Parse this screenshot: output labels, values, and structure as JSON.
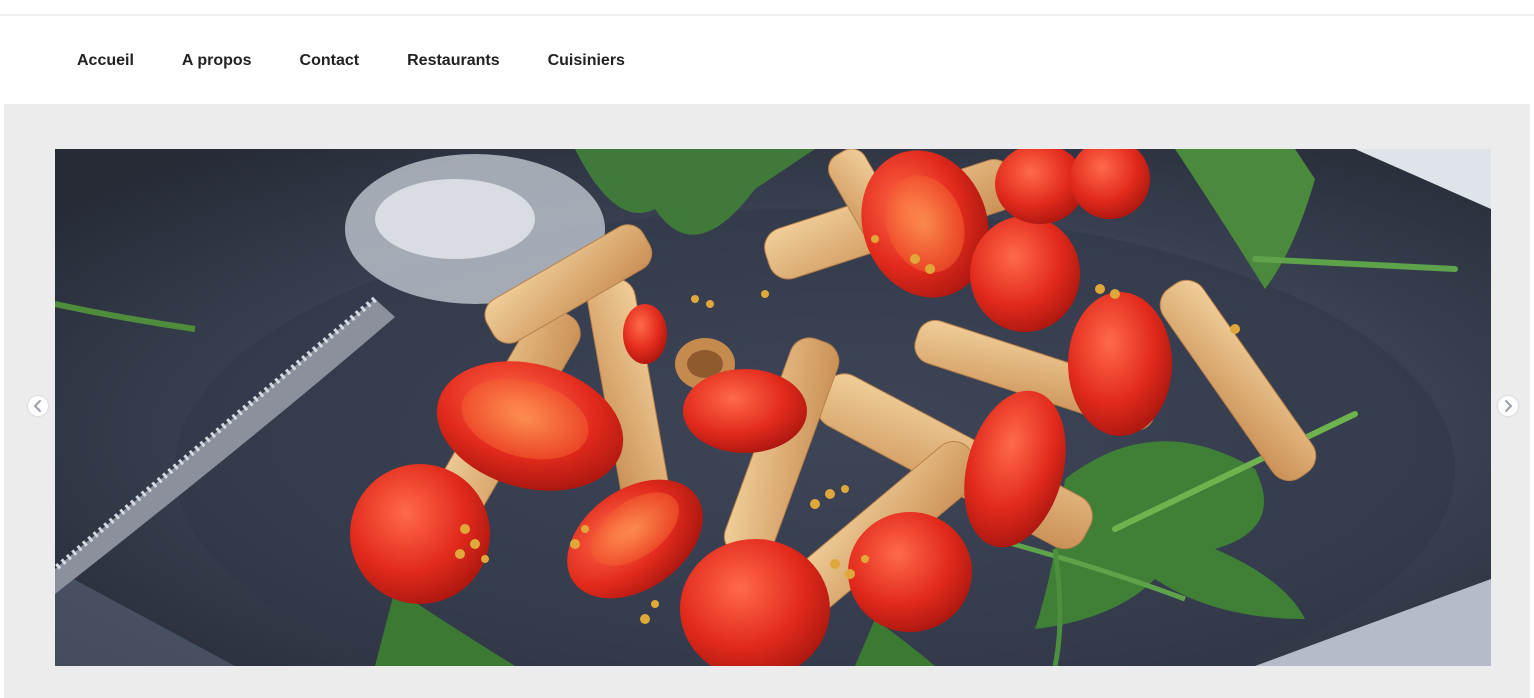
{
  "nav": {
    "items": [
      {
        "label": "Accueil"
      },
      {
        "label": "A propos"
      },
      {
        "label": "Contact"
      },
      {
        "label": "Restaurants"
      },
      {
        "label": "Cuisiniers"
      }
    ]
  },
  "carousel": {
    "slide_image": "pasta-salad-photo",
    "prev_icon": "chevron-left-icon",
    "next_icon": "chevron-right-icon"
  },
  "colors": {
    "background": "#ffffff",
    "hero_background": "#ececec",
    "nav_text": "#222222"
  }
}
